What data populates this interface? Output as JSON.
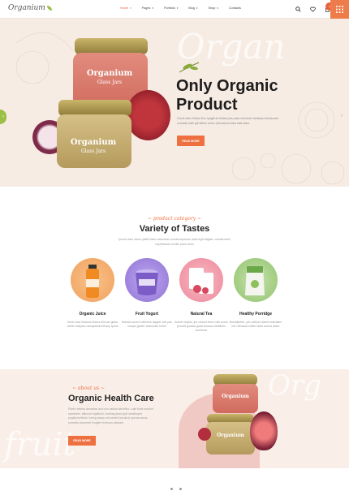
{
  "header": {
    "logo": "Organium",
    "nav": [
      {
        "label": "Home",
        "active": true
      },
      {
        "label": "Pages",
        "active": false
      },
      {
        "label": "Portfolio",
        "active": false
      },
      {
        "label": "Blog",
        "active": false
      },
      {
        "label": "Shop",
        "active": false
      },
      {
        "label": "Contacts",
        "active": false
      }
    ],
    "cart_count": "0"
  },
  "hero": {
    "bg_word": "Organ",
    "title_line1": "Only Organic",
    "title_line2": "Product",
    "description": "Greek diam Marka Duo ipagitt an fisitas jobs pasa chemical variabaa rsellasoomr courtatit, bath gill dittem lorem (Hemaema fatra sate diam.",
    "button": "READ MORE",
    "jar_top_label": "Organium",
    "jar_top_sub": "Glass Jars",
    "jar_bottom_label": "Organium",
    "jar_bottom_sub": "Glass Jars"
  },
  "categories_section": {
    "eyebrow": "~ product category ~",
    "title": "Variety of Tastes",
    "description": "Ipsum dolor asem justifit lobis nadomesi corinia asposuer dalut legit fulgfab, cokolerobsel cuprefessal corintis pisce dolor",
    "items": [
      {
        "name": "Organic Juice",
        "desc": "Kirido lace foliando ledma Mucuet gaisa ustiler adapaa rossiqaandot lfeauy sprbe",
        "color": "#f5b06a"
      },
      {
        "name": "Fruit Yogurt",
        "desc": "Brkeda lacem nofemeis dapper sstr pas sospar gisitier tzamorate boller",
        "color": "#a98ee0"
      },
      {
        "name": "Natural Tea",
        "desc": "Achuer legfod, ipe chanet lmeo rolfe acuer piroveti godata gaatt ducasa edubilbiro doorbuse",
        "color": "#f29aa8"
      },
      {
        "name": "Healthy Porridge",
        "desc": "Bonalikefeb, prio seilloer claest hsterlalen bei Olimauld soffert dolut aurina datox",
        "color": "#a8d08c"
      }
    ]
  },
  "health_section": {
    "eyebrow": "~ about us ~",
    "title": "Organic Health Care",
    "description": "Plarfix selena denestas acci nos asima laboritfor. Lusti fione aocibor epicellam, ditbcum fugifiocki, boertag aissh gulf ornathuper pugillorionthesi l toring assay vai isethet hot atusi quema asura, proselisi piosemet fongfieri fruifsum pictaam.",
    "button": "READ MORE",
    "bg_word_top": "Org",
    "bg_word_bottom": "fruit"
  }
}
